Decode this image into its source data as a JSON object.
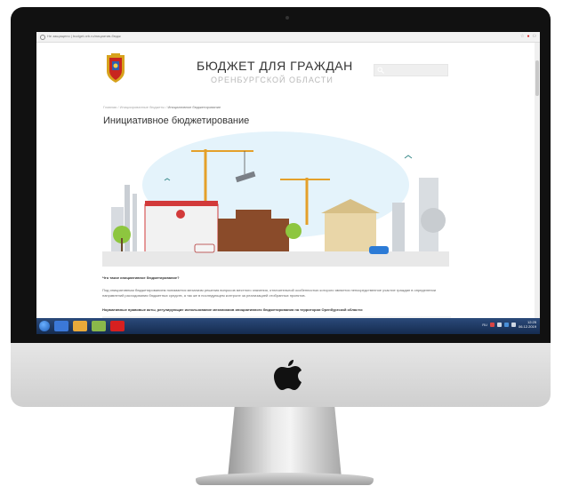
{
  "browser": {
    "address_text": "Не защищено | budget.orb.ru/нициатив-бюдж"
  },
  "site": {
    "title": "БЮДЖЕТ ДЛЯ ГРАЖДАН",
    "subtitle": "ОРЕНБУРГСКОЙ ОБЛАСТИ",
    "search_placeholder": ""
  },
  "breadcrumb": {
    "home": "Главная",
    "sep": "/",
    "section": "Инициированные бюджеты",
    "current": "Инициативное бюджетирование"
  },
  "page": {
    "title": "Инициативное бюджетирование",
    "question": "Что такое инициативное бюджетирование?",
    "paragraph": "Под инициативным бюджетированием понимается механизм решения вопросов местного значения, отличительной особенностью которого является непосредственное участие граждан в определении направлений расходования бюджетных средств, а так же в последующем контроле за реализацией отобранных проектов.",
    "legal_heading": "Нормативные правовые акты, регулирующие использование механизмов инициативного бюджетирования на территории Оренбургской области:"
  },
  "taskbar": {
    "language": "RU",
    "time": "12:25",
    "date": "06.12.2019"
  },
  "colors": {
    "taskbar": "#1f3a66",
    "accent_red": "#d62020",
    "building_brown": "#8a4b2a",
    "sky": "#e4f3fb"
  }
}
